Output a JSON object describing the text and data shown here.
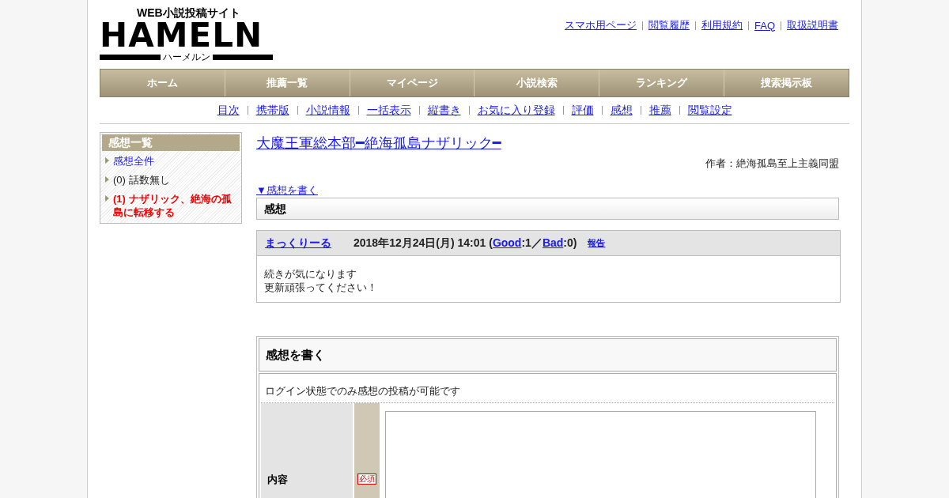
{
  "logo": {
    "tagline": "WEB小説投稿サイト",
    "name": "HAMELN",
    "reading": "ハーメルン"
  },
  "top_links": [
    "スマホ用ページ",
    "閲覧履歴",
    "利用規約",
    "FAQ",
    "取扱説明書"
  ],
  "nav": [
    "ホーム",
    "推薦一覧",
    "マイページ",
    "小説検索",
    "ランキング",
    "捜索掲示板"
  ],
  "sub_nav": [
    "目次",
    "携帯版",
    "小説情報",
    "一括表示",
    "縦書き",
    "お気に入り登録",
    "評価",
    "感想",
    "推薦",
    "閲覧設定"
  ],
  "sidebar": {
    "title": "感想一覧",
    "items": [
      {
        "kind": "link",
        "text": "感想全件"
      },
      {
        "kind": "plain",
        "text": "(0) 話数無し"
      },
      {
        "kind": "current",
        "text": "(1) ナザリック、絶海の孤島に転移する"
      }
    ]
  },
  "novel": {
    "title": "大魔王軍総本部━絶海孤島ナザリック━",
    "author": "作者：絶海孤島至上主義同盟"
  },
  "write_link": "▼感想を書く",
  "section_title": "感想",
  "comment": {
    "author": "まっくりーる",
    "header_parts": [
      {
        "kind": "text",
        "text": "2018年12月24日(月) 14:01 ("
      },
      {
        "kind": "link",
        "text": "Good"
      },
      {
        "kind": "text",
        "text": ":1／"
      },
      {
        "kind": "link",
        "text": "Bad"
      },
      {
        "kind": "text",
        "text": ":0)"
      }
    ],
    "report": "報告",
    "body": [
      "続きが気になります",
      "更新頑張ってください！"
    ]
  },
  "form": {
    "title": "感想を書く",
    "notice": "ログイン状態でのみ感想の投稿が可能です",
    "field_label": "内容",
    "required": "必須"
  }
}
